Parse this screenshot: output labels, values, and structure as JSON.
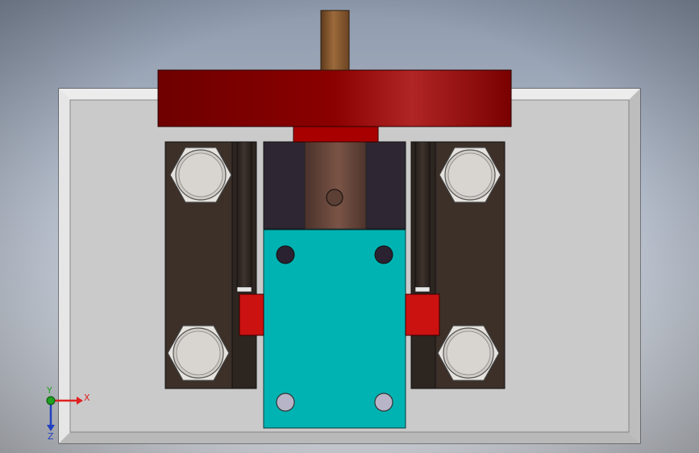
{
  "viewport": {
    "background_top": "#8e9aad",
    "background_bottom": "#dfe3ea"
  },
  "colors": {
    "base_plate": "#c9c9c9",
    "base_plate_bevel": "#e2e2e2",
    "guide_block": "#3c3029",
    "guide_rail": "#2f2723",
    "cylinder_body": "#2e2733",
    "piston_rod": "#6b4a3c",
    "shaft": "#8b5a2b",
    "flywheel": "#8b0000",
    "flywheel_highlight": "#b22222",
    "hub": "#a80000",
    "slider": "#00b3b3",
    "stop_block": "#cc1111",
    "hex_bolt": "#d8d5d0",
    "hex_bolt_outline": "#555555",
    "screw_dark": "#2a2230",
    "screw_light": "#b8b4c8"
  },
  "triad": {
    "x_label": "X",
    "y_label": "Y",
    "z_label": "Z",
    "x_color": "#e02020",
    "y_color": "#20a020",
    "z_color": "#2040c0"
  }
}
